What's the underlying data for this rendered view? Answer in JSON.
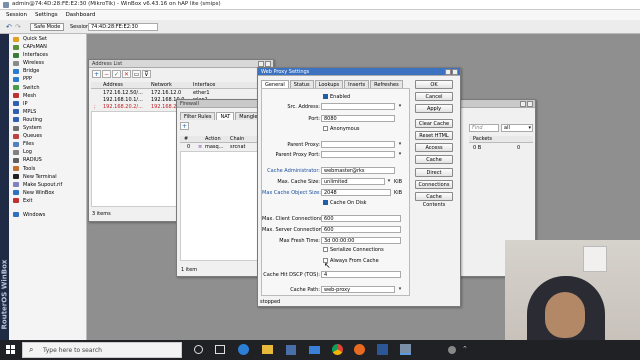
{
  "app": {
    "title": "admin@74:4D:28:FE:E2:30 (MikroTik) - WinBox v6.43.16 on hAP lite (smips)",
    "menu": [
      "Session",
      "Settings",
      "Dashboard"
    ],
    "safe_mode": "Safe Mode",
    "session_label": "Session:",
    "session_value": "74:4D:28:FE:E2:30",
    "vertical_brand": "RouterOS WinBox"
  },
  "sidebar": {
    "items": [
      {
        "label": "Quick Set",
        "color": "#e0a020"
      },
      {
        "label": "CAPsMAN",
        "color": "#5a8f3c"
      },
      {
        "label": "Interfaces",
        "color": "#3a7a3a"
      },
      {
        "label": "Wireless",
        "color": "#8a8a8a"
      },
      {
        "label": "Bridge",
        "color": "#2a7ad0"
      },
      {
        "label": "PPP",
        "color": "#2a7ad0"
      },
      {
        "label": "Switch",
        "color": "#4a9a4a"
      },
      {
        "label": "Mesh",
        "color": "#c03030"
      },
      {
        "label": "IP",
        "color": "#3060b0"
      },
      {
        "label": "MPLS",
        "color": "#3060b0"
      },
      {
        "label": "Routing",
        "color": "#3060b0"
      },
      {
        "label": "System",
        "color": "#707070"
      },
      {
        "label": "Queues",
        "color": "#c04040"
      },
      {
        "label": "Files",
        "color": "#5080c0"
      },
      {
        "label": "Log",
        "color": "#808080"
      },
      {
        "label": "RADIUS",
        "color": "#606060"
      },
      {
        "label": "Tools",
        "color": "#c07030"
      },
      {
        "label": "New Terminal",
        "color": "#202020"
      },
      {
        "label": "Make Supout.rif",
        "color": "#8080c0"
      },
      {
        "label": "New WinBox",
        "color": "#3070c0"
      },
      {
        "label": "Exit",
        "color": "#c03030"
      },
      {
        "label": "Windows",
        "color": "#3070c0"
      }
    ]
  },
  "address_list": {
    "title": "Address List",
    "columns": [
      "Address",
      "Network",
      "Interface"
    ],
    "rows": [
      {
        "address": "172.16.12.50/...",
        "network": "172.16.12.0",
        "interface": "ether1"
      },
      {
        "address": "192.168.10.1/...",
        "network": "192.168.10.0",
        "interface": "wlan1"
      },
      {
        "address": "192.168.20.2/...",
        "network": "192.168.20.0",
        "interface": "ether2"
      }
    ],
    "status": "3 items"
  },
  "firewall": {
    "title": "Firewall",
    "tabs": [
      "Filter Rules",
      "NAT",
      "Mangle",
      "R"
    ],
    "columns": [
      "#",
      "Action",
      "Chain"
    ],
    "row": {
      "num": "0",
      "action": "masq...",
      "chain": "srcnat"
    },
    "status": "1 item",
    "find": "Find",
    "filter_all": "all",
    "right_col_packets": "Packets",
    "right_col_bytes": "0 B",
    "right_col_zero": "0"
  },
  "proxy": {
    "title": "Web Proxy Settings",
    "tabs": [
      "General",
      "Status",
      "Lookups",
      "Inserts",
      "Refreshes"
    ],
    "enabled": "Enabled",
    "src_address_label": "Src. Address:",
    "src_address": "",
    "port_label": "Port:",
    "port": "8080",
    "anonymous": "Anonymous",
    "parent_proxy_label": "Parent Proxy:",
    "parent_proxy_port_label": "Parent Proxy Port:",
    "cache_admin_label": "Cache Administrator:",
    "cache_admin": "webmaster@rks",
    "max_cache_size_label": "Max. Cache Size:",
    "max_cache_size": "unlimited",
    "max_cache_obj_label": "Max Cache Object Size:",
    "max_cache_obj": "2048",
    "kib": "KiB",
    "cache_on_disk": "Cache On Disk",
    "max_client_conn_label": "Max. Client Connections:",
    "max_client_conn": "600",
    "max_server_conn_label": "Max. Server Connections:",
    "max_server_conn": "600",
    "max_fresh_label": "Max Fresh Time:",
    "max_fresh": "3d 00:00:00",
    "serialize": "Serialize Connections",
    "always_from_cache": "Always From Cache",
    "cache_hit_label": "Cache Hit DSCP (TOS):",
    "cache_hit": "4",
    "cache_path_label": "Cache Path:",
    "cache_path": "web-proxy",
    "status": "stopped",
    "buttons": [
      "OK",
      "Cancel",
      "Apply",
      "Clear Cache",
      "Reset HTML",
      "Access",
      "Cache",
      "Direct",
      "Connections",
      "Cache Contents"
    ]
  },
  "taskbar": {
    "search_placeholder": "Type here to search"
  }
}
